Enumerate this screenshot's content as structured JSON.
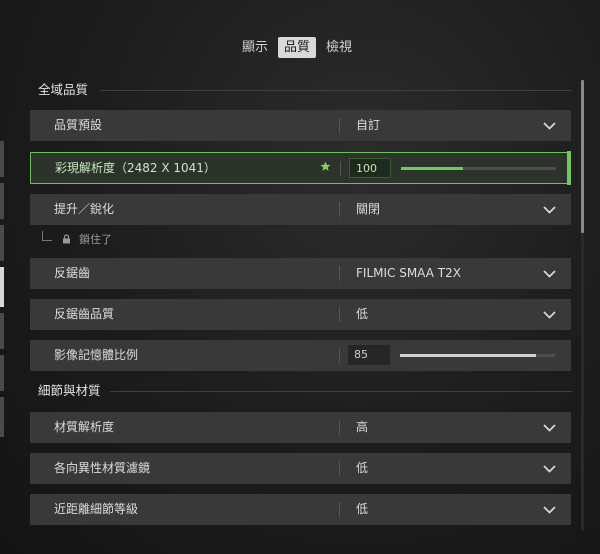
{
  "tabs": [
    {
      "label": "顯示",
      "active": false
    },
    {
      "label": "品質",
      "active": true
    },
    {
      "label": "檢視",
      "active": false
    }
  ],
  "sections": {
    "global": {
      "title": "全域品質"
    },
    "details": {
      "title": "細節與材質"
    }
  },
  "rows": {
    "quality_preset": {
      "label": "品質預設",
      "value": "自訂"
    },
    "render_resolution": {
      "label": "彩現解析度（2482 X 1041）",
      "value": "100",
      "level": 0.4,
      "favorite_icon": "star-icon"
    },
    "upscale": {
      "label": "提升／銳化",
      "value": "關閉",
      "locked_text": "鎖住了",
      "locked_icon": "lock-icon"
    },
    "anti_aliasing": {
      "label": "反鋸齒",
      "value": "FILMIC SMAA T2X"
    },
    "aa_quality": {
      "label": "反鋸齒品質",
      "value": "低"
    },
    "vram_scale": {
      "label": "影像記憶體比例",
      "value": "85",
      "level": 0.88
    },
    "texture_resolution": {
      "label": "材質解析度",
      "value": "高"
    },
    "anisotropic": {
      "label": "各向異性材質濾鏡",
      "value": "低"
    },
    "near_lod": {
      "label": "近距離細節等級",
      "value": "低"
    }
  },
  "colors": {
    "accent": "#72c95f",
    "row_bg": "#393939",
    "highlight_bg": "#2b332b"
  }
}
